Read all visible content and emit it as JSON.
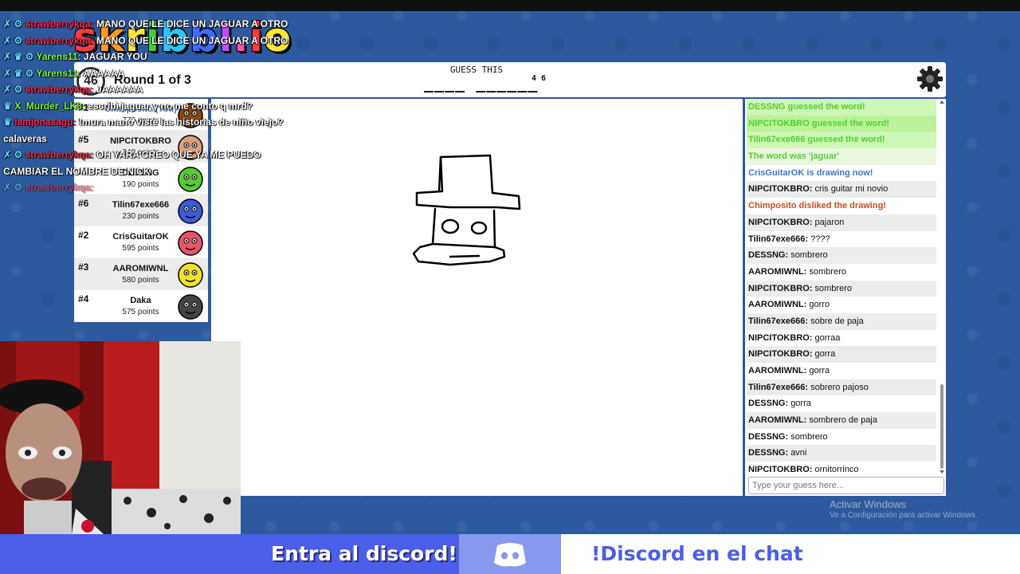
{
  "game": {
    "logo": "skribbl.io",
    "timer": "46",
    "round": "Round 1 of 3",
    "guess_label": "GUESS THIS",
    "word_hint": "____ ______",
    "word_count": "4 6"
  },
  "players": [
    {
      "rank": "#1",
      "name": "Chimposito (You)",
      "points": "770 points",
      "self": true,
      "avatar_color": "#8b4513"
    },
    {
      "rank": "#5",
      "name": "NIPCITOKBRO",
      "points": "340 points",
      "avatar_color": "#d9a07a"
    },
    {
      "rank": "#7",
      "name": "DESSNG",
      "points": "190 points",
      "avatar_color": "#55cc33"
    },
    {
      "rank": "#6",
      "name": "Tilin67exe666",
      "points": "230 points",
      "avatar_color": "#3b5bd9"
    },
    {
      "rank": "#2",
      "name": "CrisGuitarOK",
      "points": "595 points",
      "avatar_color": "#e8556b"
    },
    {
      "rank": "#3",
      "name": "AAROMIWNL",
      "points": "580 points",
      "avatar_color": "#f2e22e"
    },
    {
      "rank": "#4",
      "name": "Daka",
      "points": "575 points",
      "avatar_color": "#444444"
    }
  ],
  "chat": {
    "messages": [
      {
        "type": "guessed",
        "text": "DESSNG guessed the word!"
      },
      {
        "type": "guessed",
        "text": "NIPCITOKBRO guessed the word!"
      },
      {
        "type": "guessed",
        "text": "Tilin67exe666 guessed the word!"
      },
      {
        "type": "word",
        "text": "The word was 'jaguar'"
      },
      {
        "type": "drawing",
        "text": "CrisGuitarOK is drawing now!"
      },
      {
        "type": "user",
        "user": "NIPCITOKBRO:",
        "text": "cris guitar mi novio"
      },
      {
        "type": "disliked",
        "text": "Chimposito disliked the drawing!"
      },
      {
        "type": "user",
        "user": "NIPCITOKBRO:",
        "text": "pajaron"
      },
      {
        "type": "user",
        "user": "Tilin67exe666:",
        "text": "????"
      },
      {
        "type": "user",
        "user": "DESSNG:",
        "text": "sombrero"
      },
      {
        "type": "user",
        "user": "AAROMIWNL:",
        "text": "sombrero"
      },
      {
        "type": "user",
        "user": "NIPCITOKBRO:",
        "text": "sombrero"
      },
      {
        "type": "user",
        "user": "AAROMIWNL:",
        "text": "gorro"
      },
      {
        "type": "user",
        "user": "Tilin67exe666:",
        "text": "sobre de paja"
      },
      {
        "type": "user",
        "user": "NIPCITOKBRO:",
        "text": "gorraa"
      },
      {
        "type": "user",
        "user": "NIPCITOKBRO:",
        "text": "gorra"
      },
      {
        "type": "user",
        "user": "AAROMIWNL:",
        "text": "gorra"
      },
      {
        "type": "user",
        "user": "Tilin67exe666:",
        "text": "sobrero pajoso"
      },
      {
        "type": "user",
        "user": "DESSNG:",
        "text": "gorra"
      },
      {
        "type": "user",
        "user": "AAROMIWNL:",
        "text": "sombrero de paja"
      },
      {
        "type": "user",
        "user": "DESSNG:",
        "text": "sombrero"
      },
      {
        "type": "user",
        "user": "DESSNG:",
        "text": "avni"
      },
      {
        "type": "user",
        "user": "NIPCITOKBRO:",
        "text": "ornitorrinco"
      }
    ],
    "input_placeholder": "Type your guess here..."
  },
  "stream_chat": [
    {
      "user": "strawberrykqa:",
      "user_color": "red",
      "text": "MANO QUE LE DICE UN JAGUAR A OTRO",
      "badge": "✗ ⚙"
    },
    {
      "user": "strawberrykqa:",
      "user_color": "red",
      "text": "MANO QUE LE DICE UN JAGUAR A OTRO",
      "badge": "✗ ⚙"
    },
    {
      "user": "Yarens11:",
      "user_color": "green",
      "text": "JAGUAR YOU",
      "badge": "✗ ♛ ⚙"
    },
    {
      "user": "Yarens11:",
      "user_color": "green",
      "text": "AAAAAA",
      "badge": "✗ ♛ ⚙"
    },
    {
      "user": "strawberrykqa:",
      "user_color": "red",
      "text": "JAAAAAA",
      "badge": "✗ ⚙"
    },
    {
      "user": "X_Murder_LK8:",
      "user_color": "green",
      "text": "escribi jaguar y no me conto q mrd?",
      "badge": "♛"
    },
    {
      "user": "iamjonasagu:",
      "user_color": "red",
      "text": "!mura mano viste las historias de niño viejo? calaveras",
      "badge": "♛"
    },
    {
      "user": "strawberrykqa:",
      "user_color": "red",
      "text": "OH YARA CREO QUE YA ME PUEDO CAMBIAR EL NOMBRE DE NICK",
      "badge": "✗ ⚙"
    },
    {
      "user": "strawberrykqa:",
      "user_color": "red",
      "text": "",
      "badge": "✗ ⚙",
      "faded": true
    }
  ],
  "watermark": {
    "line1": "Activar Windows",
    "line2": "Ve a Configuración para activar Windows."
  },
  "banner": {
    "left": "Entra al discord!",
    "right": "!Discord en el chat"
  },
  "colors": {
    "background": "#2d5a9e",
    "banner": "#4b5ee8",
    "guessed": "#4fcf30",
    "drawing": "#3a78c9",
    "disliked": "#ce4b1e"
  }
}
